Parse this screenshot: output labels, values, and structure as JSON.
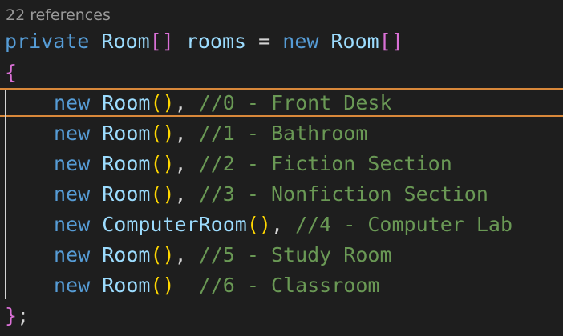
{
  "codelens": {
    "text": "22 references"
  },
  "declaration": {
    "modifier": "private",
    "type": "Room",
    "brackets": "[]",
    "name": "rooms",
    "equals": "=",
    "new_kw": "new",
    "init_type": "Room",
    "init_brackets": "[]"
  },
  "open_brace": "{",
  "close_brace": "}",
  "semicolon": ";",
  "items": [
    {
      "kw": "new",
      "type": "Room",
      "parens": "()",
      "sep": ",",
      "gap": " ",
      "comment": "//0 - Front Desk"
    },
    {
      "kw": "new",
      "type": "Room",
      "parens": "()",
      "sep": ",",
      "gap": " ",
      "comment": "//1 - Bathroom"
    },
    {
      "kw": "new",
      "type": "Room",
      "parens": "()",
      "sep": ",",
      "gap": " ",
      "comment": "//2 - Fiction Section"
    },
    {
      "kw": "new",
      "type": "Room",
      "parens": "()",
      "sep": ",",
      "gap": " ",
      "comment": "//3 - Nonfiction Section"
    },
    {
      "kw": "new",
      "type": "ComputerRoom",
      "parens": "()",
      "sep": ",",
      "gap": " ",
      "comment": "//4 - Computer Lab"
    },
    {
      "kw": "new",
      "type": "Room",
      "parens": "()",
      "sep": ",",
      "gap": " ",
      "comment": "//5 - Study Room"
    },
    {
      "kw": "new",
      "type": "Room",
      "parens": "()",
      "sep": "",
      "gap": "  ",
      "comment": "//6 - Classroom"
    }
  ],
  "colors": {
    "background": "#1e1e1e",
    "keyword": "#569cd6",
    "type": "#4ec9b0",
    "comment": "#6a9955",
    "bracket": "#da70d6",
    "paren": "#ffd700",
    "current_line_border": "#d9883a"
  }
}
